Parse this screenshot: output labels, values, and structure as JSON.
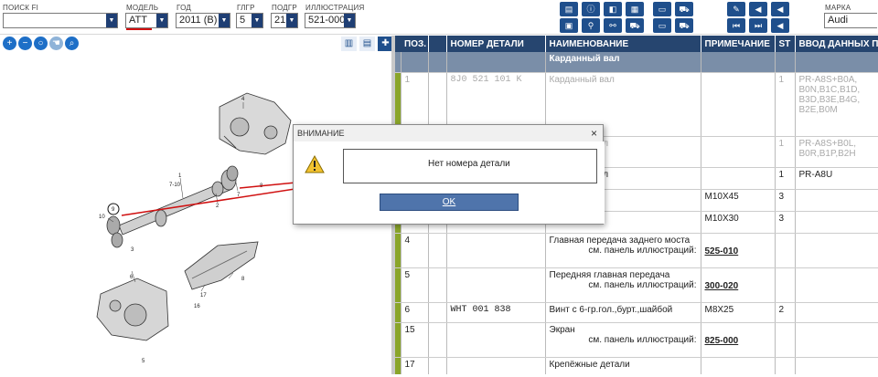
{
  "filters": {
    "search": {
      "label": "ПОИСК FI",
      "value": ""
    },
    "model": {
      "label": "МОДЕЛЬ",
      "value": "ATT"
    },
    "year": {
      "label": "ГОД",
      "value": "2011 (B)"
    },
    "glgr": {
      "label": "ГЛГР",
      "value": "5"
    },
    "podgr": {
      "label": "ПОДГР",
      "value": "21"
    },
    "illustration": {
      "label": "ИЛЛЮСТРАЦИЯ",
      "value": "521-000"
    },
    "brand": {
      "label": "МАРКА",
      "value": "Audi"
    }
  },
  "table": {
    "headers": [
      "ПОЗ.",
      "НОМЕР ДЕТАЛИ",
      "НАИМЕНОВАНИЕ",
      "ПРИМЕЧАНИЕ",
      "ST",
      "ВВОД ДАННЫХ ПО"
    ],
    "group_title": "Карданный вал",
    "rows": [
      {
        "pos": "1",
        "part": "8J0 521 101 K",
        "name": "Карданный вал",
        "note": "",
        "st": "1",
        "input": "PR-A8S+B0A, B0N,B1C,B1D, B3D,B3E,B4G, B2E,B0M",
        "dim": true
      },
      {
        "pos": "",
        "part": "",
        "name": "вал",
        "note": "",
        "st": "1",
        "input": "PR-A8S+B0L, B0R,B1P,B2H",
        "dim": true
      },
      {
        "pos": "",
        "part": "",
        "name": "вал",
        "note": "",
        "st": "1",
        "input": "PR-A8U",
        "dim": false
      },
      {
        "pos": "",
        "part": "",
        "name": "",
        "note": "M10X45",
        "st": "3",
        "input": "",
        "dim": false
      },
      {
        "pos": "",
        "part": "",
        "name": "",
        "note": "M10X30",
        "st": "3",
        "input": "",
        "dim": false
      },
      {
        "pos": "4",
        "part": "",
        "name": "Главная передача заднего моста",
        "cross": "см. панель иллюстраций:",
        "ref": "525-010",
        "note": "",
        "st": "",
        "input": "",
        "dim": false
      },
      {
        "pos": "5",
        "part": "",
        "name": "Передняя главная передача",
        "cross": "см. панель иллюстраций:",
        "ref": "300-020",
        "note": "",
        "st": "",
        "input": "",
        "dim": false
      },
      {
        "pos": "6",
        "part": "WHT 001 838",
        "name": "Винт с 6-гр.гол.,бурт.,шайбой",
        "note": "M8X25",
        "st": "2",
        "input": "",
        "dim": false
      },
      {
        "pos": "15",
        "part": "",
        "name": "Экран",
        "cross": "см. панель иллюстраций:",
        "ref": "825-000",
        "note": "",
        "st": "",
        "input": "",
        "dim": false
      },
      {
        "pos": "17",
        "part": "",
        "name": "Крепёжные детали",
        "cross": "",
        "ref": "",
        "note": "",
        "st": "",
        "input": "",
        "dim": false
      }
    ]
  },
  "diagram": {
    "callouts": [
      "4",
      "1",
      "7-10",
      "7",
      "2",
      "8",
      "10",
      "9",
      "3",
      "6",
      "17",
      "16",
      "8",
      "5"
    ]
  },
  "dialog": {
    "title": "ВНИМАНИЕ",
    "close": "×",
    "message": "Нет номера детали",
    "ok": "OK"
  },
  "colors": {
    "header_bg": "#26456f",
    "group_bg": "#7a8ea8",
    "marker_green": "#8aa52a",
    "annotation_red": "#d01010"
  }
}
